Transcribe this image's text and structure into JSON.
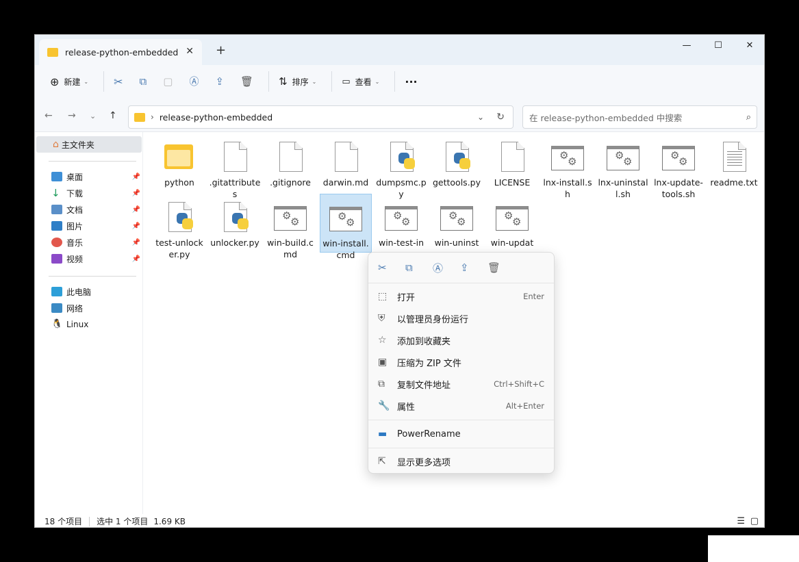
{
  "tab": {
    "title": "release-python-embedded",
    "close": "✕",
    "new": "+"
  },
  "window_controls": {
    "minimize": "—",
    "maximize": "☐",
    "close": "✕"
  },
  "toolbar": {
    "new_label": "新建",
    "sort_label": "排序",
    "view_label": "查看",
    "more": "···"
  },
  "address": {
    "path": "release-python-embedded"
  },
  "search": {
    "placeholder": "在 release-python-embedded 中搜索"
  },
  "sidebar": {
    "home": "主文件夹",
    "pinned": [
      "桌面",
      "下载",
      "文档",
      "图片",
      "音乐",
      "视频"
    ],
    "devices": [
      "此电脑",
      "网络",
      "Linux"
    ]
  },
  "files": [
    {
      "name": "python",
      "type": "folder"
    },
    {
      "name": ".gitattributes",
      "type": "doc"
    },
    {
      "name": ".gitignore",
      "type": "doc"
    },
    {
      "name": "darwin.md",
      "type": "doc"
    },
    {
      "name": "dumpsmc.py",
      "type": "py"
    },
    {
      "name": "gettools.py",
      "type": "py"
    },
    {
      "name": "LICENSE",
      "type": "doc"
    },
    {
      "name": "lnx-install.sh",
      "type": "cmd"
    },
    {
      "name": "lnx-uninstall.sh",
      "type": "cmd"
    },
    {
      "name": "lnx-update-tools.sh",
      "type": "cmd"
    },
    {
      "name": "readme.txt",
      "type": "txt"
    },
    {
      "name": "test-unlocker.py",
      "type": "py"
    },
    {
      "name": "unlocker.py",
      "type": "py"
    },
    {
      "name": "win-build.cmd",
      "type": "cmd"
    },
    {
      "name": "win-install.cmd",
      "type": "cmd",
      "selected": true
    },
    {
      "name": "win-test-in",
      "type": "cmd"
    },
    {
      "name": "win-uninst",
      "type": "cmd"
    },
    {
      "name": "win-updat",
      "type": "cmd"
    }
  ],
  "status": {
    "count": "18 个项目",
    "selected": "选中 1 个项目",
    "size": "1.69 KB"
  },
  "context_menu": {
    "items": [
      {
        "label": "打开",
        "shortcut": "Enter",
        "icon": "⬚"
      },
      {
        "label": "以管理员身份运行",
        "shortcut": "",
        "icon": "⛨"
      },
      {
        "label": "添加到收藏夹",
        "shortcut": "",
        "icon": "☆"
      },
      {
        "label": "压缩为 ZIP 文件",
        "shortcut": "",
        "icon": "▣"
      },
      {
        "label": "复制文件地址",
        "shortcut": "Ctrl+Shift+C",
        "icon": "⧉"
      },
      {
        "label": "属性",
        "shortcut": "Alt+Enter",
        "icon": "🔧"
      }
    ],
    "powerrename": "PowerRename",
    "more": "显示更多选项"
  },
  "colors": {
    "accent": "#0067c0",
    "selection": "#cce4f7",
    "folder": "#f8c430",
    "python_blue": "#3a75b0",
    "python_yellow": "#f6cf3c"
  }
}
